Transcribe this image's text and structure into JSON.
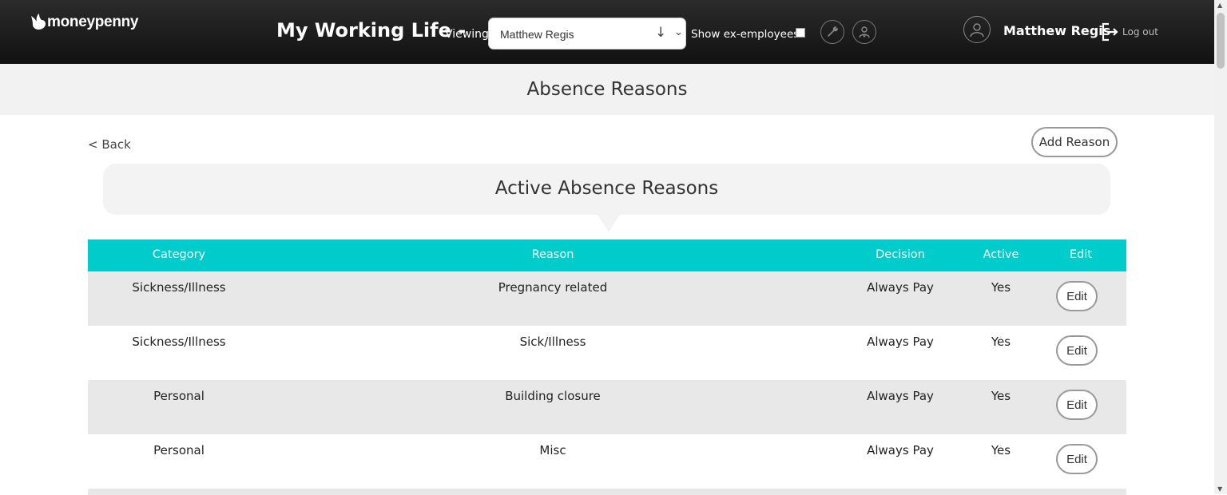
{
  "header": {
    "logo_text": "moneypenny",
    "app_title": "My Working Life -",
    "viewing_label": "Viewing",
    "viewer_select": {
      "value": "Matthew Regis"
    },
    "show_ex_label": "Show ex-employees",
    "show_ex_checked": false,
    "user_name": "Matthew Regis",
    "logout_label": "Log out"
  },
  "page": {
    "title": "Absence Reasons",
    "back_label": "< Back",
    "add_button_label": "Add Reason",
    "section_title": "Active Absence Reasons"
  },
  "table": {
    "columns": [
      "Category",
      "Reason",
      "Decision",
      "Active",
      "Edit"
    ],
    "rows": [
      {
        "category": "Sickness/Illness",
        "reason": "Pregnancy related",
        "decision": "Always Pay",
        "active": "Yes",
        "edit": "Edit"
      },
      {
        "category": "Sickness/Illness",
        "reason": "Sick/Illness",
        "decision": "Always Pay",
        "active": "Yes",
        "edit": "Edit"
      },
      {
        "category": "Personal",
        "reason": "Building closure",
        "decision": "Always Pay",
        "active": "Yes",
        "edit": "Edit"
      },
      {
        "category": "Personal",
        "reason": "Misc",
        "decision": "Always Pay",
        "active": "Yes",
        "edit": "Edit"
      }
    ]
  },
  "colors": {
    "header_bg": "#1a1a1a",
    "table_header_bg": "#00cccc",
    "row_alt_bg": "#e8e8e8",
    "title_bar_bg": "#f2f2f2"
  },
  "icons": [
    "bird-logo-icon",
    "wrench-icon",
    "user-badge-icon",
    "user-avatar-icon",
    "logout-icon",
    "arrow-down-icon",
    "chevron-down-icon"
  ]
}
